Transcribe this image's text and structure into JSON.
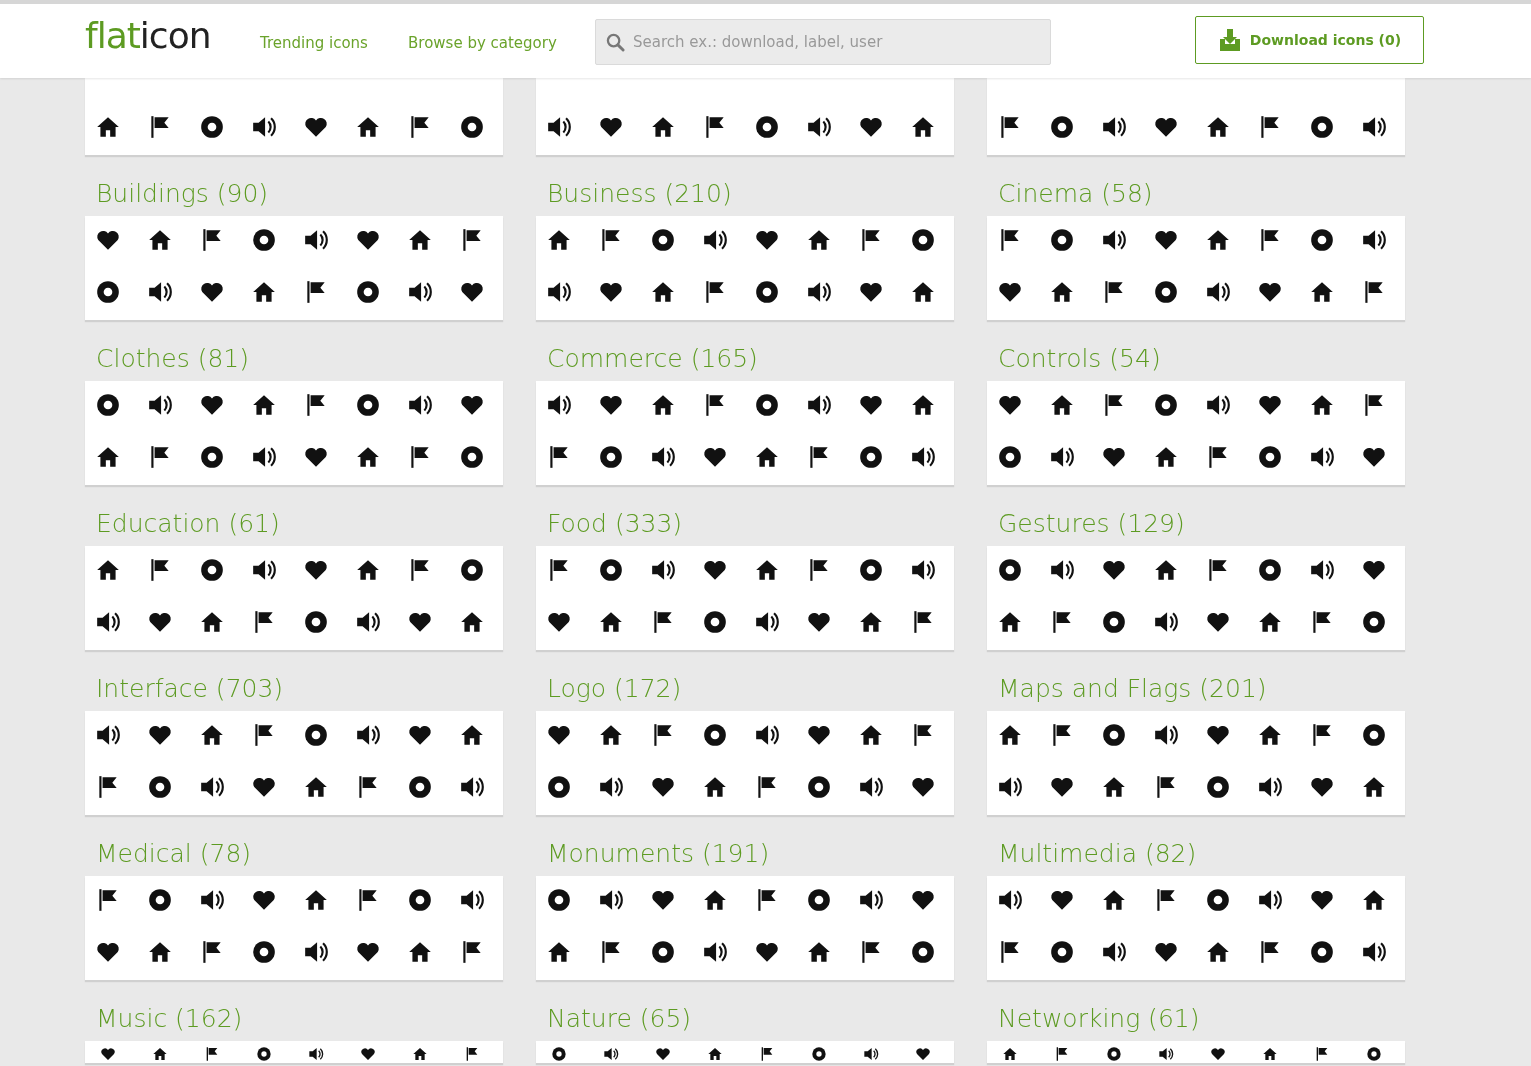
{
  "header": {
    "logo": {
      "accent": "flat",
      "rest": "icon"
    },
    "nav": [
      {
        "label": "Trending icons"
      },
      {
        "label": "Browse by category"
      }
    ],
    "search": {
      "placeholder": "Search ex.: download, label, user"
    },
    "download_button": {
      "label": "Download icons (0)"
    }
  },
  "categories": [
    {
      "title": "Buildings (90)"
    },
    {
      "title": "Business (210)"
    },
    {
      "title": "Cinema (58)"
    },
    {
      "title": "Clothes (81)"
    },
    {
      "title": "Commerce (165)"
    },
    {
      "title": "Controls (54)"
    },
    {
      "title": "Education (61)"
    },
    {
      "title": "Food (333)"
    },
    {
      "title": "Gestures (129)"
    },
    {
      "title": "Interface (703)"
    },
    {
      "title": "Logo (172)"
    },
    {
      "title": "Maps and Flags (201)"
    },
    {
      "title": "Medical (78)"
    },
    {
      "title": "Monuments (191)"
    },
    {
      "title": "Multimedia (82)"
    },
    {
      "title": "Music (162)"
    },
    {
      "title": "Nature (65)"
    },
    {
      "title": "Networking (61)"
    }
  ]
}
